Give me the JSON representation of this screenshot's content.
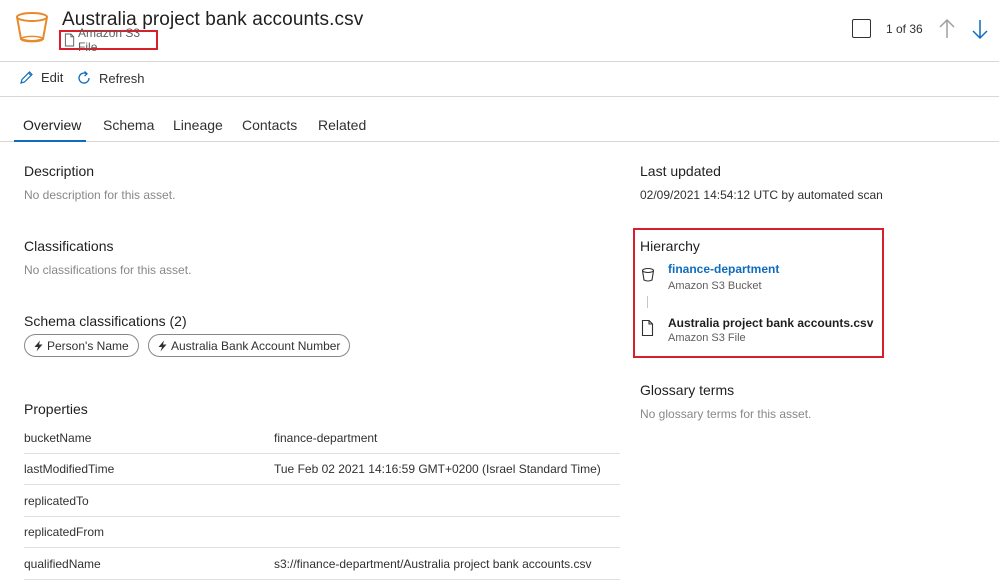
{
  "header": {
    "title": "Australia project bank accounts.csv",
    "asset_type": "Amazon S3 File",
    "pager": "1 of 36",
    "logo_icon": "s3-bucket-icon",
    "badge_color": "#d8202d"
  },
  "toolbar": {
    "edit_label": "Edit",
    "refresh_label": "Refresh"
  },
  "tabs": [
    {
      "label": "Overview",
      "active": true
    },
    {
      "label": "Schema",
      "active": false
    },
    {
      "label": "Lineage",
      "active": false
    },
    {
      "label": "Contacts",
      "active": false
    },
    {
      "label": "Related",
      "active": false
    }
  ],
  "description": {
    "heading": "Description",
    "text": "No description for this asset."
  },
  "classifications": {
    "heading": "Classifications",
    "text": "No classifications for this asset."
  },
  "schema_classifications": {
    "heading": "Schema classifications (2)",
    "chips": [
      "Person's Name",
      "Australia Bank Account Number"
    ]
  },
  "properties": {
    "heading": "Properties",
    "rows": [
      {
        "key": "bucketName",
        "value": "finance-department"
      },
      {
        "key": "lastModifiedTime",
        "value": "Tue Feb 02 2021 14:16:59 GMT+0200 (Israel Standard Time)"
      },
      {
        "key": "replicatedTo",
        "value": ""
      },
      {
        "key": "replicatedFrom",
        "value": ""
      },
      {
        "key": "qualifiedName",
        "value": "s3://finance-department/Australia project bank accounts.csv"
      }
    ]
  },
  "last_updated": {
    "heading": "Last updated",
    "text": "02/09/2021 14:54:12 UTC by automated scan"
  },
  "hierarchy": {
    "heading": "Hierarchy",
    "items": [
      {
        "name": "finance-department",
        "type": "Amazon S3 Bucket"
      },
      {
        "name": "Australia project bank accounts.csv",
        "type": "Amazon S3 File"
      }
    ]
  },
  "glossary": {
    "heading": "Glossary terms",
    "text": "No glossary terms for this asset."
  },
  "colors": {
    "accent": "#0f6cbd",
    "highlight_border": "#d8202d",
    "bucket_orange": "#e8892b"
  }
}
